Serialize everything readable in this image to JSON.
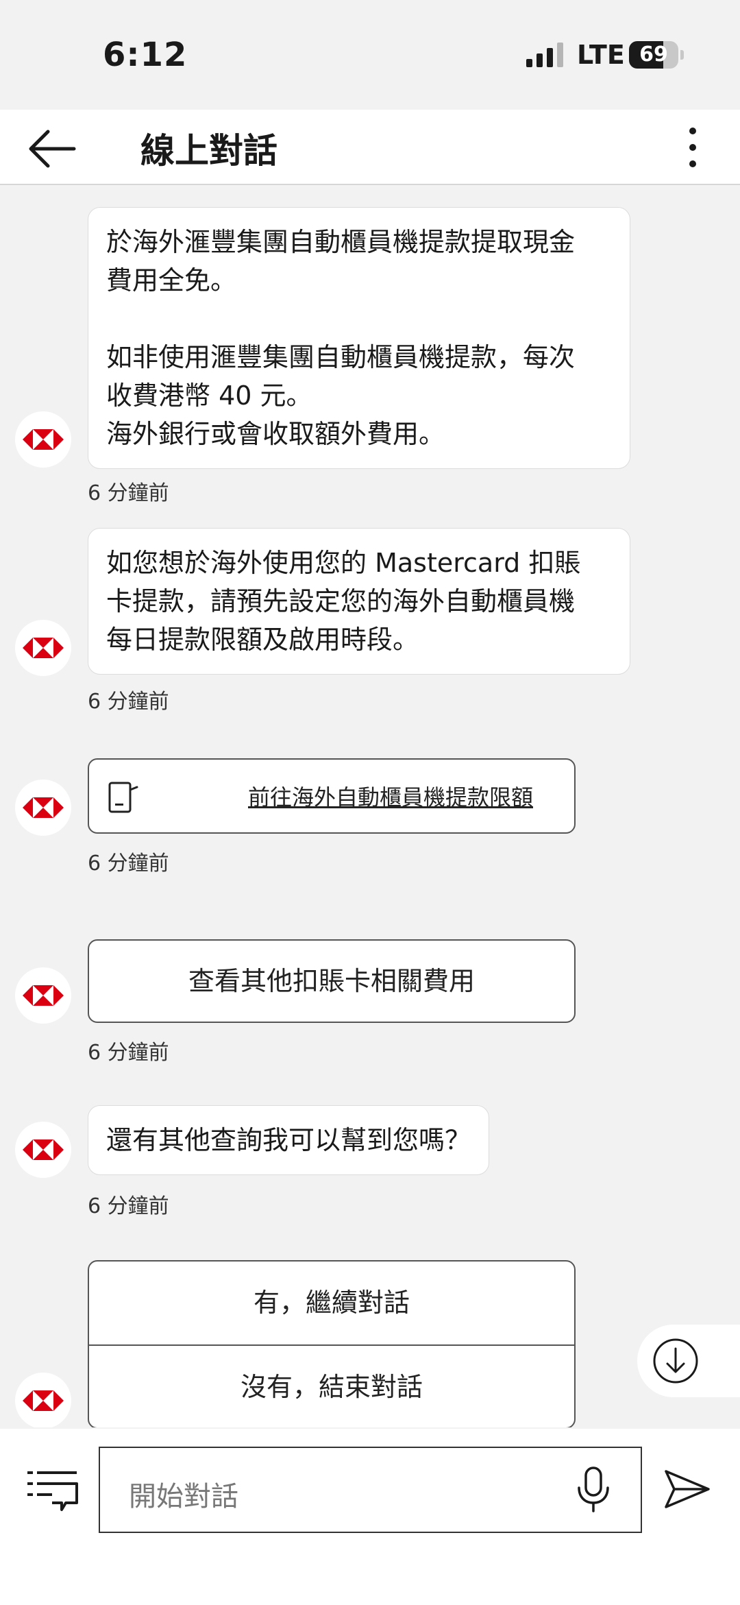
{
  "status_bar": {
    "time": "6:12",
    "network": "LTE",
    "battery_percent": 69,
    "battery_text": "69"
  },
  "header": {
    "title": "線上對話"
  },
  "colors": {
    "brand_red": "#DB0011",
    "background": "#F2F2F2"
  },
  "icons": {
    "back": "back-arrow-icon",
    "more": "more-vertical-icon",
    "avatar": "hsbc-logo-icon",
    "link": "atm-card-icon",
    "scroll": "arrow-down-circle-icon",
    "menu": "menu-icon",
    "mic": "microphone-icon",
    "send": "send-icon"
  },
  "messages": [
    {
      "text": "於海外滙豐集團自動櫃員機提款提取現金\n費用全免。\n\n如非使用滙豐集團自動櫃員機提款，每次\n收費港幣 40 元。\n海外銀行或會收取額外費用。",
      "time": "6 分鐘前"
    },
    {
      "text": "如您想於海外使用您的 Mastercard 扣賬\n卡提款，請預先設定您的海外自動櫃員機\n每日提款限額及啟用時段。",
      "time": "6 分鐘前"
    },
    {
      "link_label": "前往海外自動櫃員機提款限額",
      "time": "6 分鐘前"
    },
    {
      "button_label": "查看其他扣賬卡相關費用",
      "time": "6 分鐘前"
    },
    {
      "text": "還有其他查詢我可以幫到您嗎？",
      "time": "6 分鐘前"
    }
  ],
  "quick_replies": [
    "有，繼續對話",
    "沒有，結束對話"
  ],
  "composer": {
    "placeholder": "開始對話"
  }
}
